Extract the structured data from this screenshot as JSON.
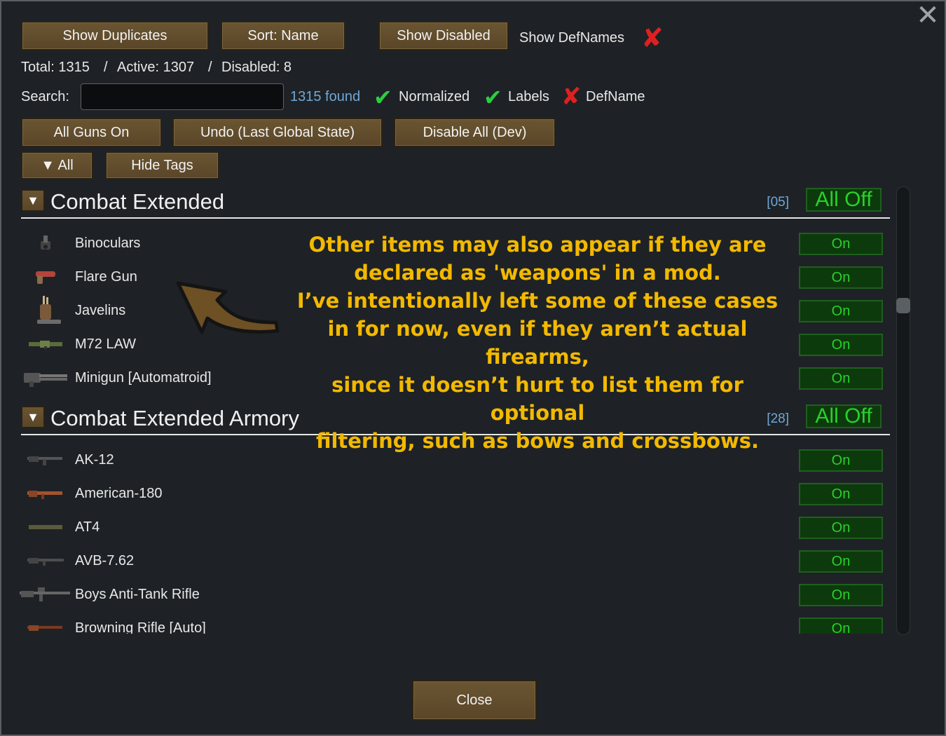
{
  "toolbar": {
    "show_duplicates": "Show Duplicates",
    "sort": "Sort: Name",
    "show_disabled": "Show Disabled",
    "show_defnames": "Show DefNames"
  },
  "stats": {
    "total": "Total: 1315",
    "sep1": "/",
    "active": "Active: 1307",
    "sep2": "/",
    "disabled": "Disabled: 8"
  },
  "search": {
    "label": "Search:",
    "value": "",
    "found": "1315 found",
    "normalized": "Normalized",
    "labels": "Labels",
    "defname": "DefName"
  },
  "actions": {
    "all_guns_on": "All Guns On",
    "undo": "Undo (Last Global State)",
    "disable_all": "Disable All (Dev)",
    "all_filter": "▼ All",
    "hide_tags": "Hide Tags"
  },
  "sections": [
    {
      "title": "Combat Extended",
      "count": "[05]",
      "toggle": "All Off",
      "items": [
        {
          "label": "Binoculars",
          "state": "On"
        },
        {
          "label": "Flare Gun",
          "state": "On"
        },
        {
          "label": "Javelins",
          "state": "On"
        },
        {
          "label": "M72 LAW",
          "state": "On"
        },
        {
          "label": "Minigun [Automatroid]",
          "state": "On"
        }
      ]
    },
    {
      "title": "Combat Extended Armory",
      "count": "[28]",
      "toggle": "All Off",
      "items": [
        {
          "label": "AK-12",
          "state": "On"
        },
        {
          "label": "American-180",
          "state": "On"
        },
        {
          "label": "AT4",
          "state": "On"
        },
        {
          "label": "AVB-7.62",
          "state": "On"
        },
        {
          "label": "Boys Anti-Tank Rifle",
          "state": "On"
        },
        {
          "label": "Browning Rifle [Auto]",
          "state": "On"
        }
      ]
    }
  ],
  "annotation": {
    "lines": [
      "Other items may also appear if they are",
      "declared as 'weapons' in a mod.",
      "I’ve intentionally left some of these cases",
      "in for now, even if they aren’t actual firearms,",
      "since it doesn’t hurt to list them for optional",
      "filtering, such as bows and crossbows."
    ]
  },
  "footer": {
    "close": "Close"
  },
  "colors": {
    "button_brown": "#5a4628",
    "on_green": "#2ad02a",
    "annotation_yellow": "#f3b900",
    "count_blue": "#6fa7d8",
    "check_green": "#2ecc40",
    "cross_red": "#e02020"
  }
}
